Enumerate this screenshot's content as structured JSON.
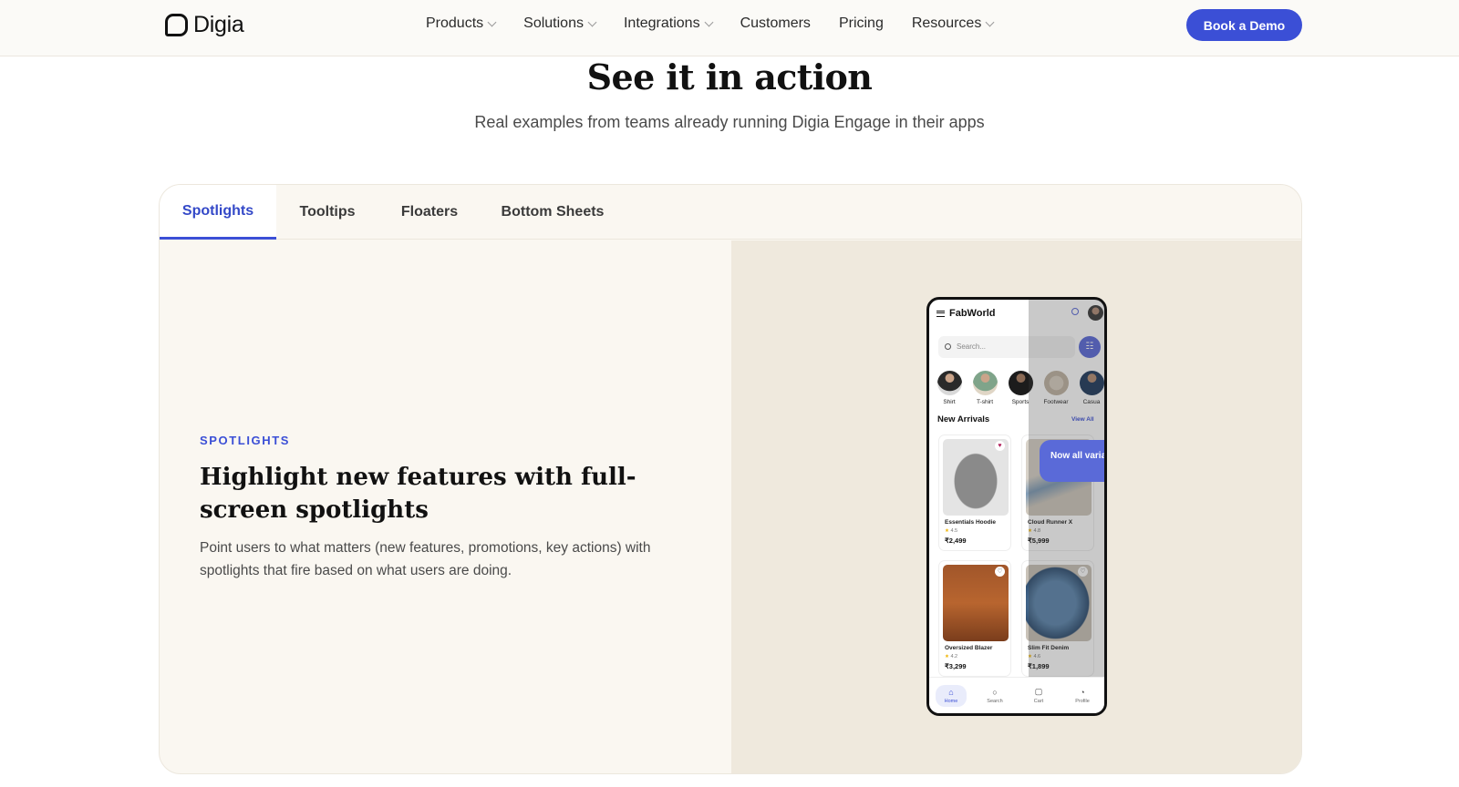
{
  "nav": {
    "logo": "Digia",
    "links": [
      {
        "label": "Products",
        "dropdown": true
      },
      {
        "label": "Solutions",
        "dropdown": true
      },
      {
        "label": "Integrations",
        "dropdown": true
      },
      {
        "label": "Customers",
        "dropdown": false
      },
      {
        "label": "Pricing",
        "dropdown": false
      },
      {
        "label": "Resources",
        "dropdown": true
      }
    ],
    "cta": "Book a Demo"
  },
  "hero": {
    "title": "See it in action",
    "subtitle": "Real examples from teams already running Digia Engage in their apps"
  },
  "tabs": [
    {
      "label": "Spotlights",
      "active": true
    },
    {
      "label": "Tooltips",
      "active": false
    },
    {
      "label": "Floaters",
      "active": false
    },
    {
      "label": "Bottom Sheets",
      "active": false
    }
  ],
  "feature": {
    "eyebrow": "SPOTLIGHTS",
    "title": "Highlight new features with full-screen spotlights",
    "description": "Point users to what matters (new features, promotions, key actions) with spotlights that fire based on what users are doing."
  },
  "phone": {
    "brand": "FabWorld",
    "search_placeholder": "Search...",
    "categories": [
      "Shirt",
      "T-shirt",
      "Sports",
      "Footwear",
      "Casua"
    ],
    "section_title": "New Arrivals",
    "view_all": "View All",
    "products": [
      {
        "name": "Essentials Hoodie",
        "rating": "4.5",
        "price": "₹2,499"
      },
      {
        "name": "Cloud Runner X",
        "rating": "4.8",
        "price": "₹5,999"
      },
      {
        "name": "Oversized Blazer",
        "rating": "4.2",
        "price": "₹3,299"
      },
      {
        "name": "Slim Fit Denim",
        "rating": "4.6",
        "price": "₹1,899"
      }
    ],
    "tooltip": "Now all varia",
    "bottom_nav": [
      "Home",
      "Search",
      "Cart",
      "Profile"
    ]
  },
  "colors": {
    "accent": "#3b4fd6",
    "card_bg": "#faf7f1",
    "pane_bg": "#efe9dd"
  }
}
